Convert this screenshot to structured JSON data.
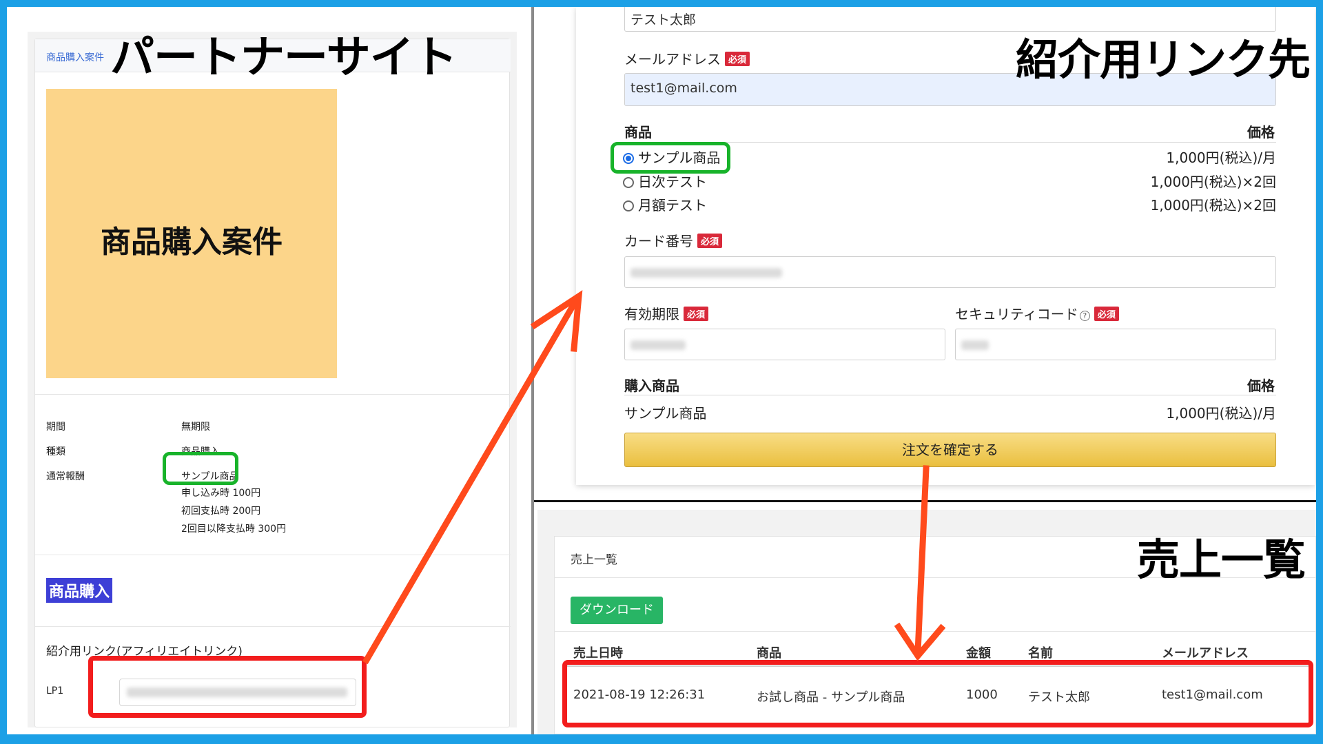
{
  "titles": {
    "partner": "パートナーサイト",
    "destination": "紹介用リンク先",
    "sales": "売上一覧"
  },
  "partner": {
    "card_header": "商品購入案件",
    "thumbnail_text": "商品購入案件",
    "details": [
      {
        "label": "期間",
        "value": "無期限"
      },
      {
        "label": "種類",
        "value": "商品購入"
      },
      {
        "label": "通常報酬",
        "value": "サンプル商品"
      }
    ],
    "reward_lines": [
      "申し込み時 100円",
      "初回支払時 200円",
      "2回目以降支払時 300円"
    ],
    "section_title": "商品購入",
    "link_section_label": "紹介用リンク(アフィリエイトリンク)",
    "lp_label": "LP1"
  },
  "form": {
    "name_value": "テスト太郎",
    "email_label": "メールアドレス",
    "required_badge": "必須",
    "email_value": "test1@mail.com",
    "product_header": "商品",
    "price_header": "価格",
    "products": [
      {
        "name": "サンプル商品",
        "price": "1,000円(税込)/月",
        "selected": true
      },
      {
        "name": "日次テスト",
        "price": "1,000円(税込)×2回",
        "selected": false
      },
      {
        "name": "月額テスト",
        "price": "1,000円(税込)×2回",
        "selected": false
      }
    ],
    "card_label": "カード番号",
    "expiry_label": "有効期限",
    "security_label": "セキュリティコード",
    "help_icon": "?",
    "purchase_header": "購入商品",
    "purchase_price_header": "価格",
    "purchase_item": "サンプル商品",
    "purchase_price": "1,000円(税込)/月",
    "order_button": "注文を確定する"
  },
  "sales": {
    "card_title": "売上一覧",
    "download_button": "ダウンロード",
    "columns": [
      "売上日時",
      "商品",
      "金額",
      "名前",
      "メールアドレス"
    ],
    "row": [
      "2021-08-19 12:26:31",
      "お試し商品 - サンプル商品",
      "1000",
      "テスト太郎",
      "test1@mail.com"
    ]
  },
  "colors": {
    "frame": "#1ca0e6",
    "highlight_green": "#18b32a",
    "highlight_red": "#f21d1d",
    "arrow": "#ff4a1c",
    "required": "#d9293a",
    "download": "#28b565"
  }
}
